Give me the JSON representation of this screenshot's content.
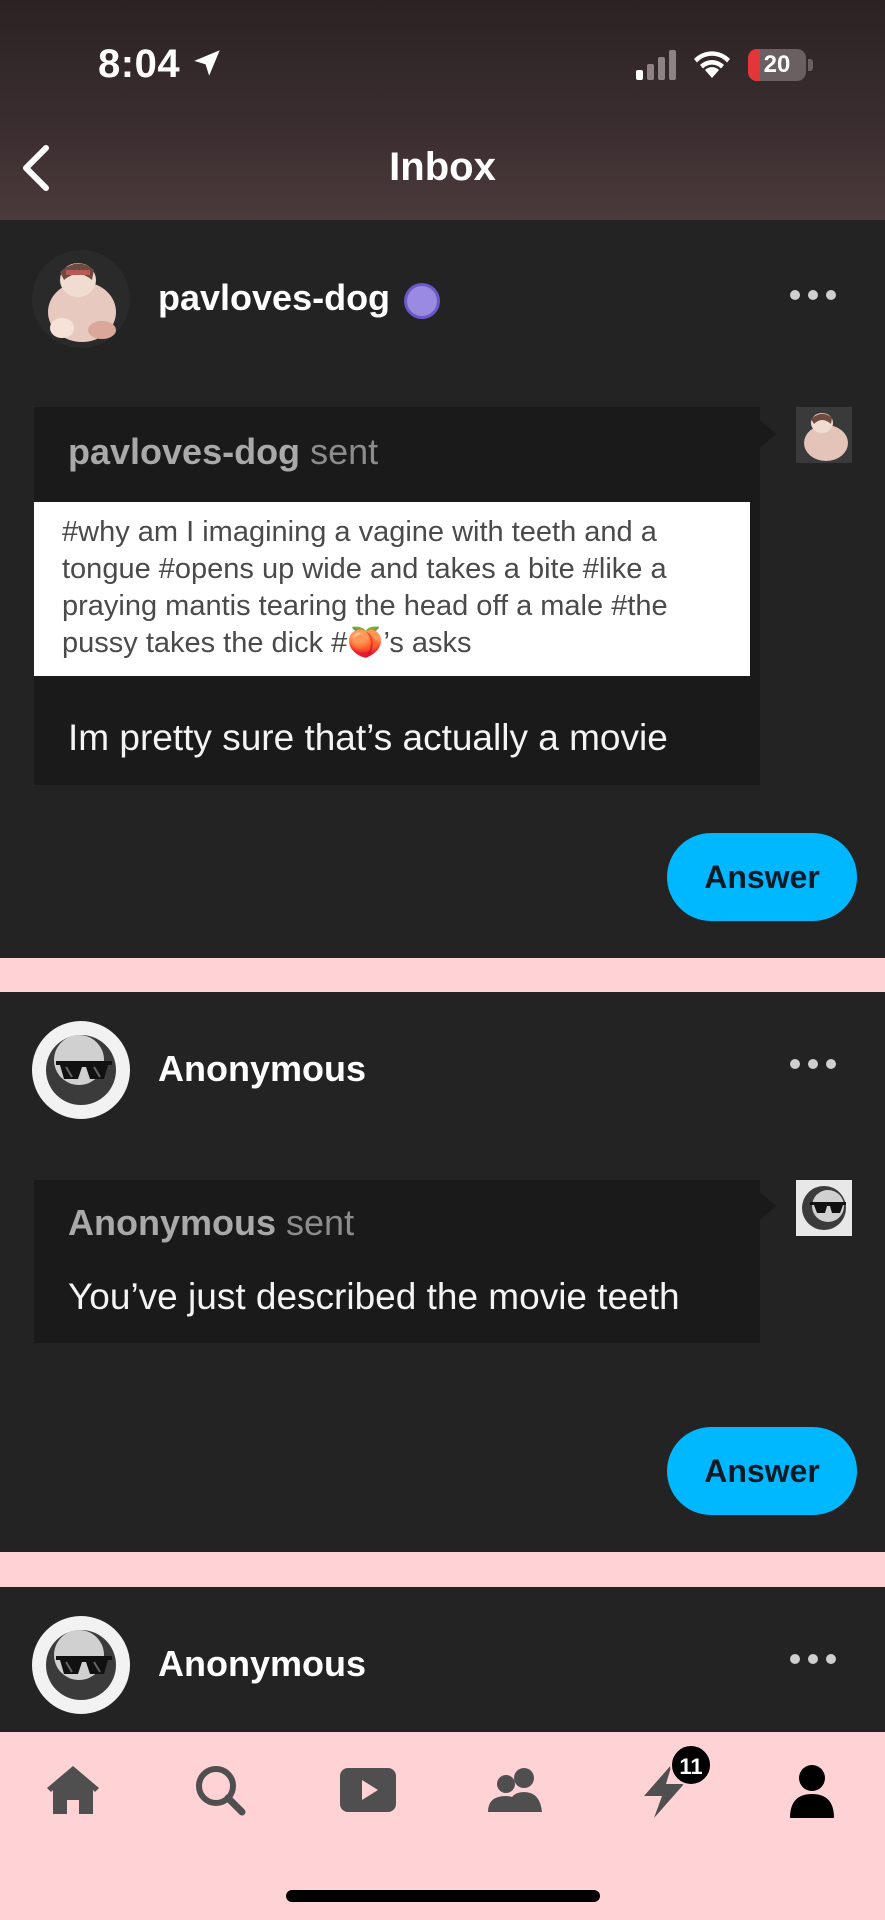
{
  "status_bar": {
    "time": "8:04",
    "battery_level": "20",
    "battery_fraction": 0.2,
    "battery_color": "#e4353a"
  },
  "header": {
    "title": "Inbox",
    "back_icon": "chevron-left-icon"
  },
  "asks": [
    {
      "username": "pavloves-dog",
      "sent_user": "pavloves-dog",
      "sent_suffix": "sent",
      "quote": "#why am I imagining a vagine with teeth and a tongue  #opens up wide and takes a bite  #like a praying mantis tearing the head off a male  #the pussy takes the dick  #",
      "quote_emoji": "🍑",
      "quote_tail": "’s asks",
      "message": "Im pretty sure that’s actually a movie",
      "answer_label": "Answer"
    },
    {
      "username": "Anonymous",
      "sent_user": "Anonymous",
      "sent_suffix": "sent",
      "message": "You’ve just described the movie teeth",
      "answer_label": "Answer"
    },
    {
      "username": "Anonymous"
    }
  ],
  "tab_bar": {
    "items": [
      "home-icon",
      "search-icon",
      "video-play-icon",
      "community-icon",
      "activity-lightning-icon",
      "account-icon"
    ],
    "activity_count": "11"
  },
  "colors": {
    "accent": "#00b8ff",
    "card_bg": "#232323",
    "page_bg": "#ffd3d6"
  }
}
